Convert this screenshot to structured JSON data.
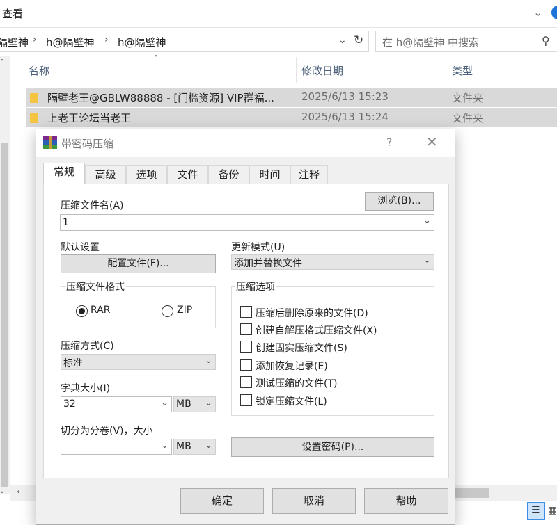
{
  "explorer": {
    "menu_view": "查看",
    "breadcrumbs": [
      "隔壁神",
      "h@隔壁神",
      "h@隔壁神"
    ],
    "search_placeholder": "在 h@隔壁神 中搜索",
    "columns": {
      "name": "名称",
      "date": "修改日期",
      "type": "类型"
    },
    "files": [
      {
        "name": "隔壁老王@GBLW88888 - [门槛资源] VIP群福...",
        "date": "2025/6/13 15:23",
        "type": "文件夹"
      },
      {
        "name": "上老王论坛当老王",
        "date": "2025/6/13 15:24",
        "type": "文件夹"
      }
    ]
  },
  "dialog": {
    "title": "带密码压缩",
    "help_glyph": "?",
    "tabs": [
      "常规",
      "高级",
      "选项",
      "文件",
      "备份",
      "时间",
      "注释"
    ],
    "active_tab": "常规",
    "archive_name_label": "压缩文件名(A)",
    "browse_button": "浏览(B)...",
    "archive_name_value": "1",
    "default_settings_label": "默认设置",
    "profiles_button": "配置文件(F)...",
    "update_mode_label": "更新模式(U)",
    "update_mode_value": "添加并替换文件",
    "format_group": "压缩文件格式",
    "format_rar": "RAR",
    "format_zip": "ZIP",
    "selected_format": "RAR",
    "method_label": "压缩方式(C)",
    "method_value": "标准",
    "dict_label": "字典大小(I)",
    "dict_value": "32",
    "dict_unit": "MB",
    "split_label": "切分为分卷(V)，大小",
    "split_value": "",
    "split_unit": "MB",
    "options_group": "压缩选项",
    "options": [
      {
        "label": "压缩后删除原来的文件(D)",
        "checked": false
      },
      {
        "label": "创建自解压格式压缩文件(X)",
        "checked": false
      },
      {
        "label": "创建固实压缩文件(S)",
        "checked": false
      },
      {
        "label": "添加恢复记录(E)",
        "checked": false
      },
      {
        "label": "测试压缩的文件(T)",
        "checked": false
      },
      {
        "label": "锁定压缩文件(L)",
        "checked": false
      }
    ],
    "set_password_button": "设置密码(P)...",
    "ok_button": "确定",
    "cancel_button": "取消",
    "help_button": "帮助"
  },
  "colors": {
    "selection_blue": "#cde8ff",
    "row_selected_inactive": "#d9d9d9",
    "dialog_bg": "#f0f0f0",
    "folder_yellow": "#f5c542",
    "column_header_text": "#4c607a"
  }
}
